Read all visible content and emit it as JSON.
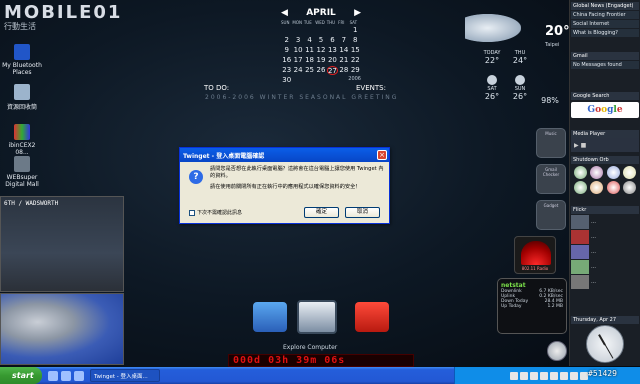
{
  "logo": {
    "text": "MOBILE01",
    "sub": "行動生活"
  },
  "desktop_icons": [
    {
      "label": "My Bluetooth Places",
      "icon": "bluetooth-icon"
    },
    {
      "label": "資源回收筒",
      "icon": "recycle-bin-icon"
    },
    {
      "label": "ibinCEX2 08...",
      "icon": "app-icon"
    },
    {
      "label": "WEBsuper Digital Mall",
      "icon": "shortcut-icon"
    }
  ],
  "calendar": {
    "month": "APRIL",
    "year": "2006",
    "dow": [
      "SUN",
      "MON",
      "TUE",
      "WED",
      "THU",
      "FRI",
      "SAT"
    ],
    "days": [
      "",
      "",
      "",
      "",
      "",
      "",
      "1",
      "2",
      "3",
      "4",
      "5",
      "6",
      "7",
      "8",
      "9",
      "10",
      "11",
      "12",
      "13",
      "14",
      "15",
      "16",
      "17",
      "18",
      "19",
      "20",
      "21",
      "22",
      "23",
      "24",
      "25",
      "26",
      "27",
      "28",
      "29",
      "30"
    ],
    "today": "27"
  },
  "todo_label": "TO DO:",
  "events_label": "EVENTS:",
  "greeting": "2006-2006 WINTER SEASONAL GREETING",
  "weather": {
    "current_temp": "20°",
    "city": "Taipei",
    "forecast": [
      {
        "day": "TODAY",
        "hi": "22°",
        "lo": "19°"
      },
      {
        "day": "THU",
        "hi": "24°",
        "lo": "20°"
      },
      {
        "day": "SAT",
        "hi": "26°",
        "lo": "21°"
      },
      {
        "day": "SUN",
        "hi": "26°",
        "lo": "22°"
      }
    ],
    "humidity": "98%"
  },
  "sidebar": {
    "news_title": "Global News (Engadget)",
    "news_items": [
      "China Facing Frontier",
      "Social Internet",
      "What is Blogging?"
    ],
    "mail_title": "Gmail",
    "mail_item": "No Messages found",
    "search_title": "Google Search",
    "media_title": "Media Player",
    "shutdown_title": "Shutdown Orb",
    "feeds_title": "Flickr",
    "date_text": "Thursday, Apr 27"
  },
  "side_gadgets": [
    "Music",
    "Gmail Checker",
    "Gadget"
  ],
  "wifi": {
    "label": "802.11 Radio"
  },
  "netstat": {
    "title": "netstat",
    "rows": [
      {
        "k": "Downlink",
        "v": "6.7 KB/sec"
      },
      {
        "k": "Uplink",
        "v": "0.2 KB/sec"
      },
      {
        "k": "Down Today",
        "v": "28.4 MB"
      },
      {
        "k": "Up Today",
        "v": "1.2 MB"
      }
    ]
  },
  "camera_label": "6TH / WADSWORTH",
  "dialog": {
    "title": "Twinget - 登入桌面電腦確認",
    "message_1": "請問您是否想在此執行桌面電腦？這將會在這台電腦上讓您使用 Twinget 內的資料。",
    "message_2": "請在使用前關閉所有正在執行中的應用程式以確保您資料的安全！",
    "checkbox": "下次不需確認此訊息",
    "ok": "確定",
    "cancel": "取消"
  },
  "dock": {
    "label": "Explore Computer"
  },
  "countdown": "000d 03h 39m 06s",
  "taskbar": {
    "start": "start",
    "task": "Twinget - 登入桌面..."
  },
  "watermark": "#51429",
  "colors": {
    "taskbar": "#245edb",
    "start": "#379a31",
    "accent_red": "#e01010"
  }
}
